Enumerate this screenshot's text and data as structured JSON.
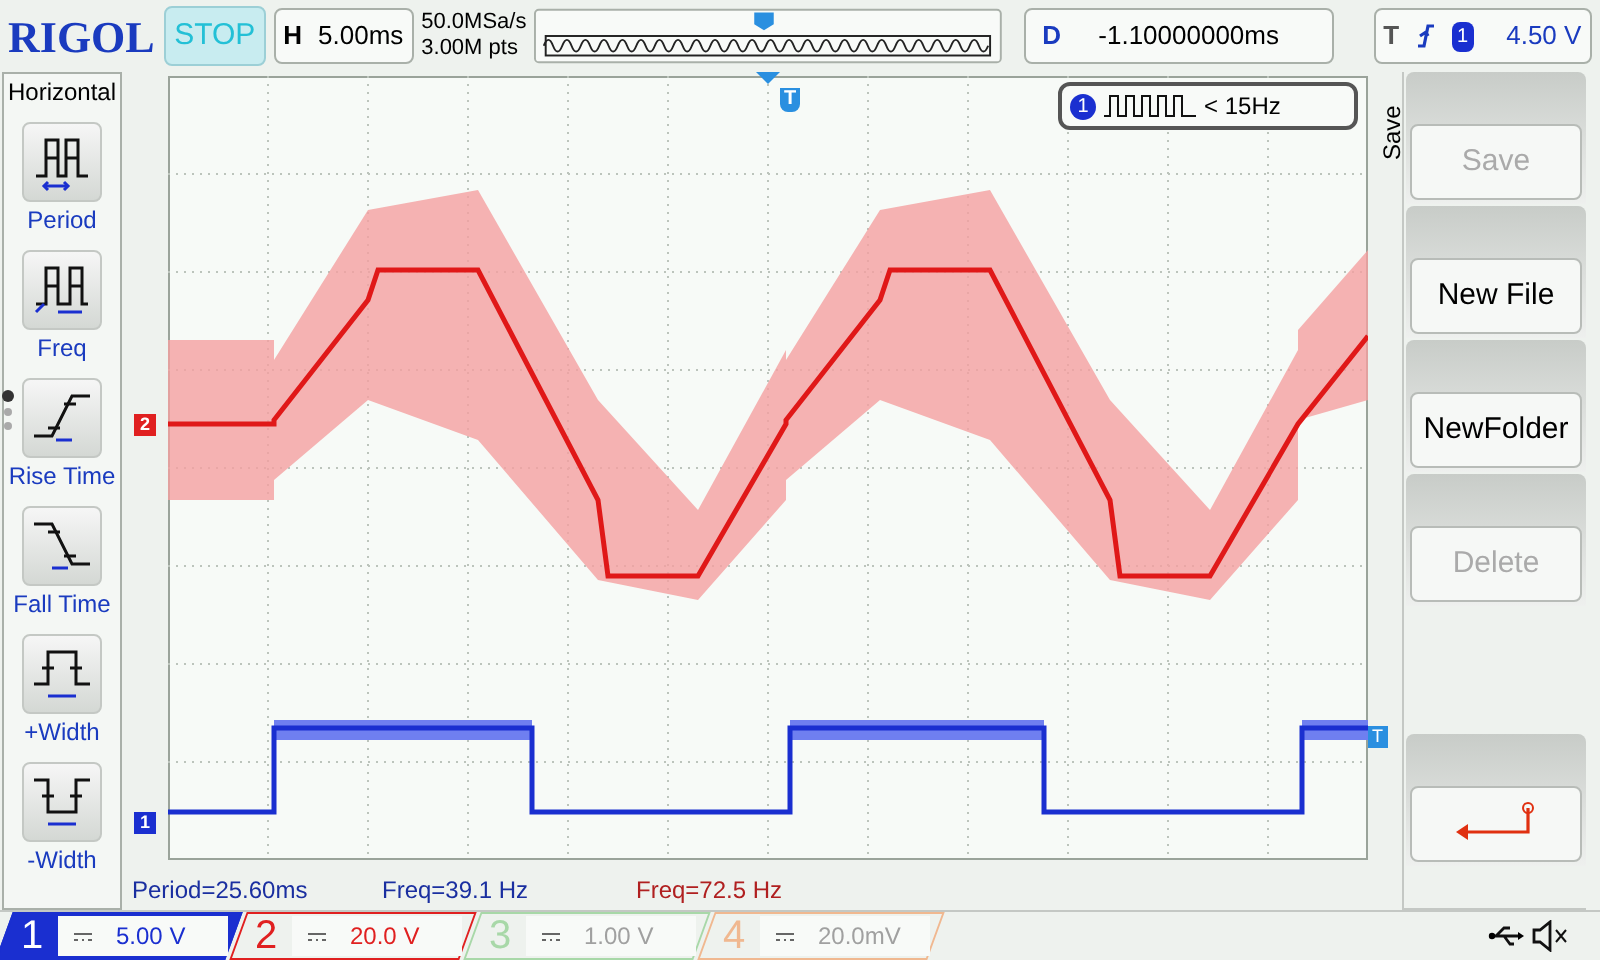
{
  "header": {
    "logo": "RIGOL",
    "run_state": "STOP",
    "horizontal": {
      "label": "H",
      "value": "5.00ms"
    },
    "sample_rate": "50.0MSa/s",
    "memory_depth": "3.00M pts",
    "delay": {
      "label": "D",
      "value": "-1.10000000ms"
    },
    "trigger": {
      "label": "T",
      "source": "1",
      "level": "4.50 V"
    }
  },
  "left_menu": {
    "title": "Horizontal",
    "page_dots": [
      {
        "selected": true
      },
      {
        "selected": false
      },
      {
        "selected": false
      }
    ],
    "items": [
      {
        "kind": "period",
        "label": "Period"
      },
      {
        "kind": "freq",
        "label": "Freq"
      },
      {
        "kind": "rise",
        "label": "Rise Time"
      },
      {
        "kind": "fall",
        "label": "Fall Time"
      },
      {
        "kind": "pwidth",
        "label": "+Width"
      },
      {
        "kind": "nwidth",
        "label": "-Width"
      }
    ]
  },
  "screen": {
    "counter": {
      "channel": "1",
      "reading": "< 15Hz"
    },
    "trigger_position_marker": "T",
    "trigger_level_marker": "T",
    "channel_markers": [
      {
        "label": "2",
        "color": "#e02020"
      },
      {
        "label": "1",
        "color": "#1a2fd0"
      }
    ]
  },
  "measurements": [
    {
      "text": "Period=25.60ms",
      "color": "#1a2fa0"
    },
    {
      "text": "Freq=39.1 Hz",
      "color": "#1a2fa0"
    },
    {
      "text": "Freq=72.5 Hz",
      "color": "#b02020"
    }
  ],
  "channels": [
    {
      "number": "1",
      "scale": "5.00 V",
      "on": true,
      "selected": true,
      "color": "#1a2fd0"
    },
    {
      "number": "2",
      "scale": "20.0 V",
      "on": true,
      "selected": false,
      "color": "#e02020"
    },
    {
      "number": "3",
      "scale": "1.00 V",
      "on": false,
      "selected": false,
      "color": "#a8d8a8"
    },
    {
      "number": "4",
      "scale": "20.0mV",
      "on": false,
      "selected": false,
      "color": "#f0b890"
    }
  ],
  "right_menu": {
    "title": "Save",
    "buttons": [
      {
        "kind": "text",
        "label": "Save",
        "disabled": true
      },
      {
        "kind": "text",
        "label": "New File",
        "disabled": false
      },
      {
        "kind": "text",
        "label": "NewFolder",
        "disabled": false
      },
      {
        "kind": "text",
        "label": "Delete",
        "disabled": true
      },
      {
        "kind": "spacer"
      },
      {
        "kind": "return"
      }
    ]
  }
}
